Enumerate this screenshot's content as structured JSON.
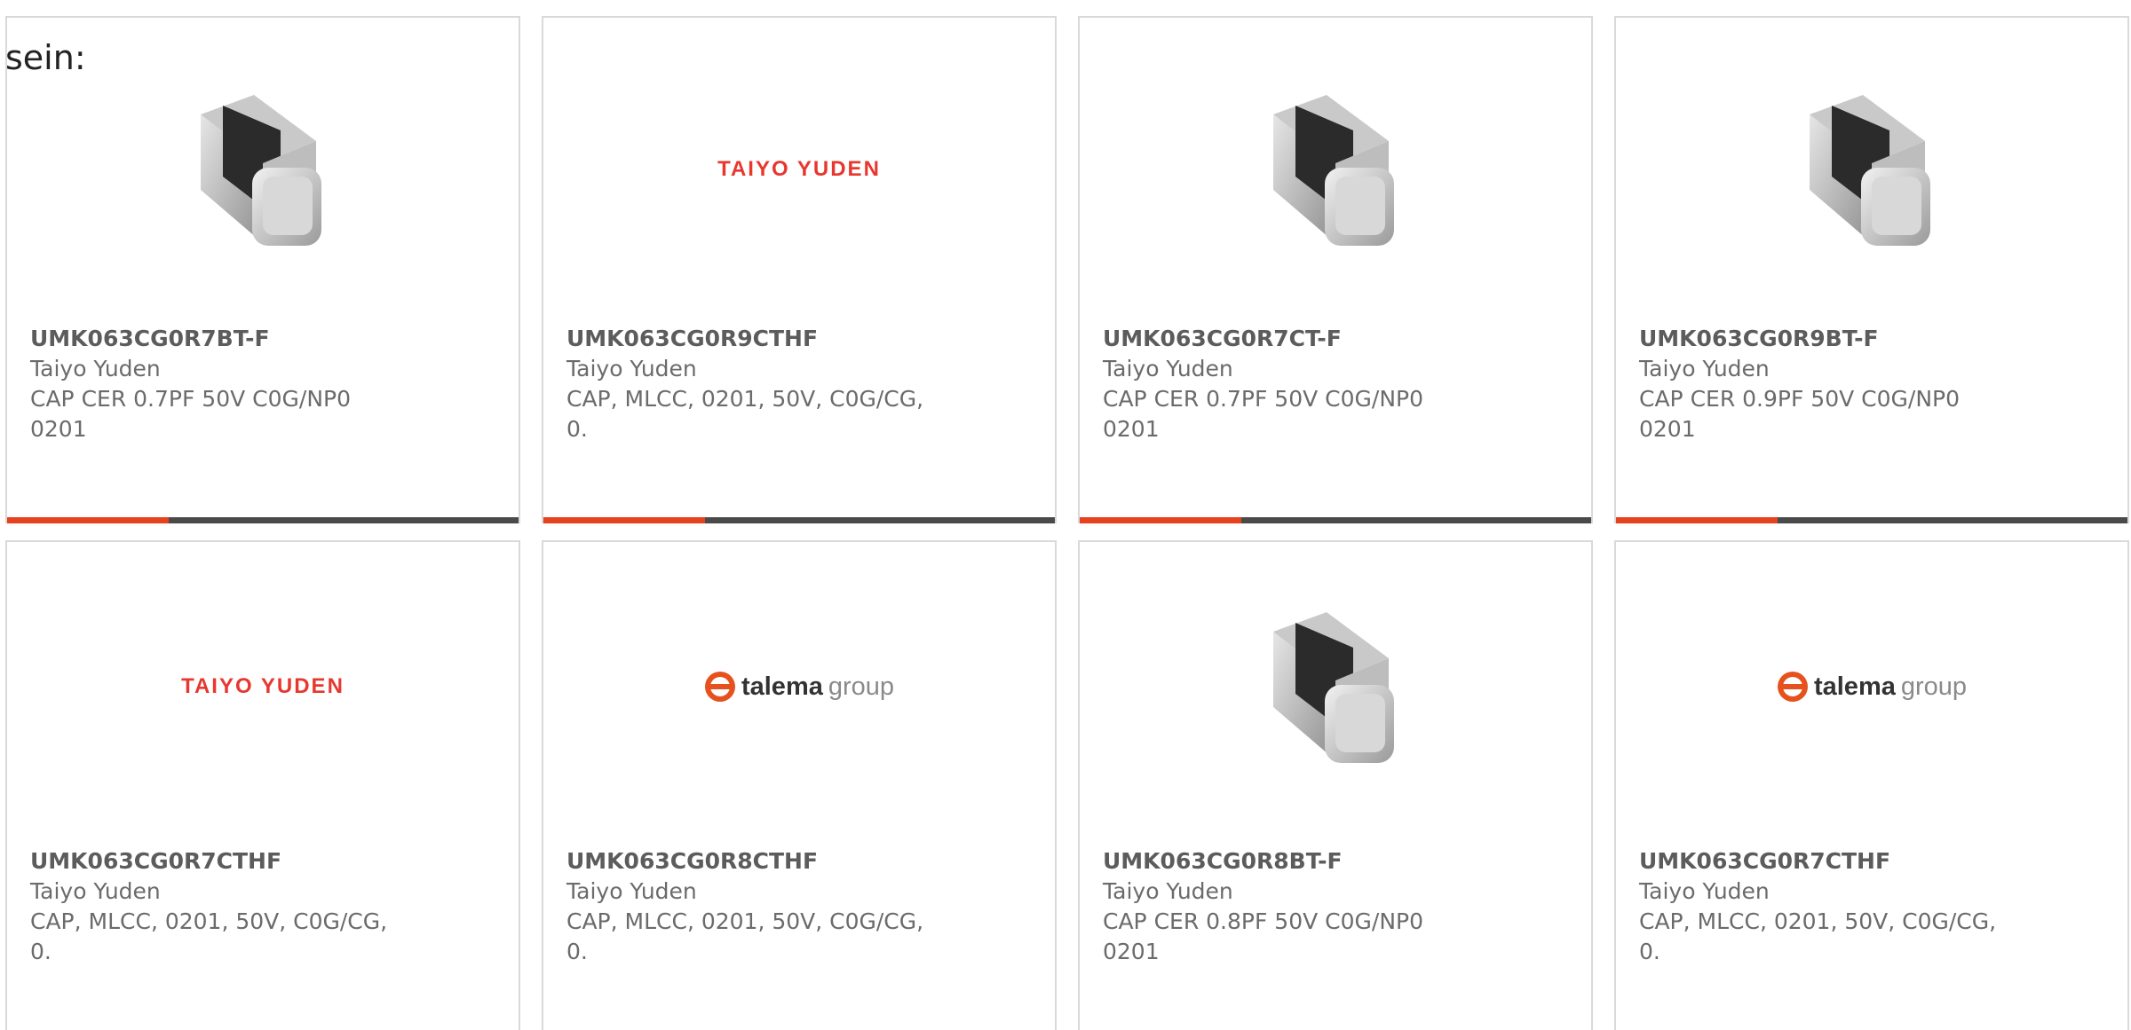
{
  "intro_text": "sein:",
  "colors": {
    "card_border": "#d9d9d9",
    "accent": "#e5421d",
    "bar_dark": "#4a4a4a",
    "text": "#6b6b6b",
    "taiyo_red": "#e8372f"
  },
  "products": [
    {
      "part_number": "UMK063CG0R7BT-F",
      "manufacturer": "Taiyo Yuden",
      "desc_line1": "CAP CER 0.7PF 50V C0G/NP0",
      "desc_line2": "0201",
      "image": "mlcc-chip-image"
    },
    {
      "part_number": "UMK063CG0R9CTHF",
      "manufacturer": "Taiyo Yuden",
      "desc_line1": "CAP, MLCC, 0201, 50V, C0G/CG,",
      "desc_line2": "0.",
      "image": "taiyo-yuden-logo",
      "logo_text": "TAIYO YUDEN"
    },
    {
      "part_number": "UMK063CG0R7CT-F",
      "manufacturer": "Taiyo Yuden",
      "desc_line1": "CAP CER 0.7PF 50V C0G/NP0",
      "desc_line2": "0201",
      "image": "mlcc-chip-image"
    },
    {
      "part_number": "UMK063CG0R9BT-F",
      "manufacturer": "Taiyo Yuden",
      "desc_line1": "CAP CER 0.9PF 50V C0G/NP0",
      "desc_line2": "0201",
      "image": "mlcc-chip-image"
    },
    {
      "part_number": "UMK063CG0R7CTHF",
      "manufacturer": "Taiyo Yuden",
      "desc_line1": "CAP, MLCC, 0201, 50V, C0G/CG,",
      "desc_line2": "0.",
      "image": "taiyo-yuden-logo",
      "logo_text": "TAIYO YUDEN"
    },
    {
      "part_number": "UMK063CG0R8CTHF",
      "manufacturer": "Taiyo Yuden",
      "desc_line1": "CAP, MLCC, 0201, 50V, C0G/CG,",
      "desc_line2": "0.",
      "image": "talema-group-logo",
      "logo_text_bold": "talema",
      "logo_text_light": "group"
    },
    {
      "part_number": "UMK063CG0R8BT-F",
      "manufacturer": "Taiyo Yuden",
      "desc_line1": "CAP CER 0.8PF 50V C0G/NP0",
      "desc_line2": "0201",
      "image": "mlcc-chip-image"
    },
    {
      "part_number": "UMK063CG0R7CTHF",
      "manufacturer": "Taiyo Yuden",
      "desc_line1": "CAP, MLCC, 0201, 50V, C0G/CG,",
      "desc_line2": "0.",
      "image": "talema-group-logo",
      "logo_text_bold": "talema",
      "logo_text_light": "group"
    }
  ]
}
